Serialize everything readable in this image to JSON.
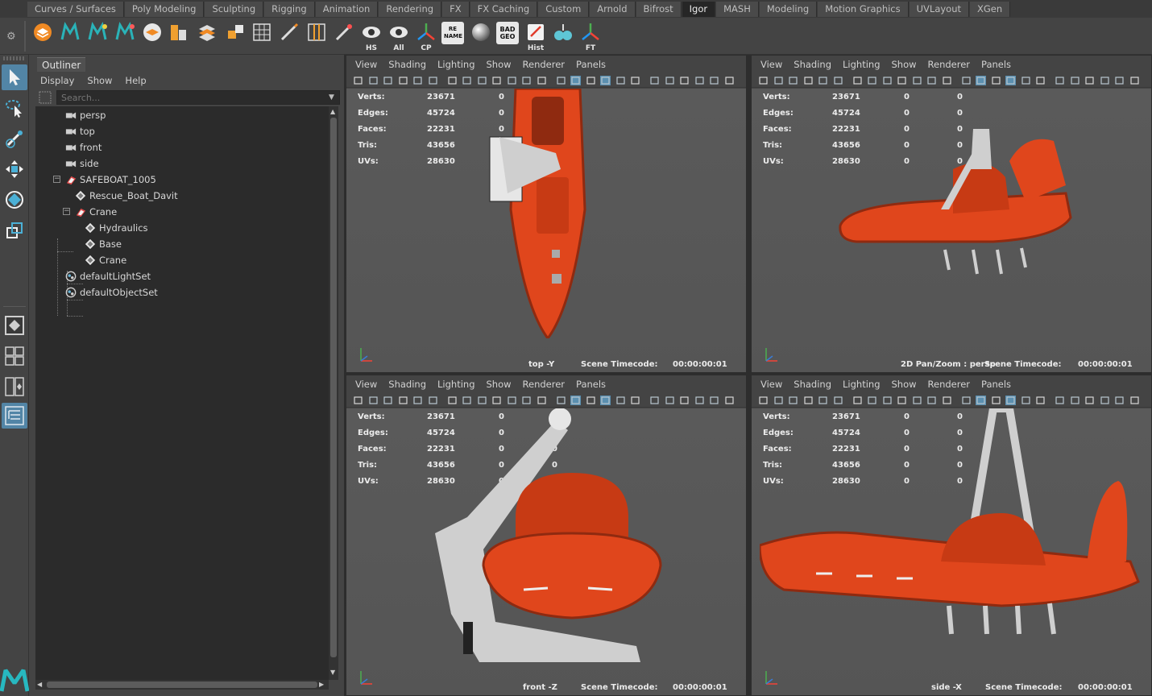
{
  "shelf": {
    "tabs": [
      "Curves / Surfaces",
      "Poly Modeling",
      "Sculpting",
      "Rigging",
      "Animation",
      "Rendering",
      "FX",
      "FX Caching",
      "Custom",
      "Arnold",
      "Bifrost",
      "Igor",
      "MASH",
      "Modeling",
      "Motion Graphics",
      "UVLayout",
      "XGen"
    ],
    "active_tab": "Igor",
    "labels": {
      "hs": "HS",
      "all": "All",
      "cp": "CP",
      "rename": "RE\nNAME",
      "badgeo": "BAD\nGEO",
      "hist": "Hist",
      "ft": "FT"
    },
    "rename_text": "RE NAME",
    "badgeo_text": "BAD GEO"
  },
  "outliner": {
    "tab_title": "Outliner",
    "menu": [
      "Display",
      "Show",
      "Help"
    ],
    "search_placeholder": "Search...",
    "items": [
      {
        "label": "persp",
        "icon": "camera-icon"
      },
      {
        "label": "top",
        "icon": "camera-icon"
      },
      {
        "label": "front",
        "icon": "camera-icon"
      },
      {
        "label": "side",
        "icon": "camera-icon"
      },
      {
        "label": "SAFEBOAT_1005",
        "icon": "group-icon"
      },
      {
        "label": "Rescue_Boat_Davit",
        "icon": "mesh-icon"
      },
      {
        "label": "Crane",
        "icon": "group-icon"
      },
      {
        "label": "Hydraulics",
        "icon": "mesh-icon"
      },
      {
        "label": "Base",
        "icon": "mesh-icon"
      },
      {
        "label": "Crane",
        "icon": "mesh-icon"
      },
      {
        "label": "defaultLightSet",
        "icon": "set-icon"
      },
      {
        "label": "defaultObjectSet",
        "icon": "set-icon"
      }
    ]
  },
  "viewport_menu": [
    "View",
    "Shading",
    "Lighting",
    "Show",
    "Renderer",
    "Panels"
  ],
  "hud": {
    "labels": [
      "Verts:",
      "Edges:",
      "Faces:",
      "Tris:",
      "UVs:"
    ],
    "values": [
      "23671",
      "45724",
      "22231",
      "43656",
      "28630"
    ],
    "zero": "0"
  },
  "viewports": [
    {
      "camera": "top -Y",
      "timecode_label": "Scene Timecode:",
      "timecode": "00:00:00:01",
      "extra": ""
    },
    {
      "camera": "persp",
      "timecode_label": "Scene Timecode:",
      "timecode": "00:00:00:01",
      "extra": "2D Pan/Zoom : persp"
    },
    {
      "camera": "front -Z",
      "timecode_label": "Scene Timecode:",
      "timecode": "00:00:00:01",
      "extra": ""
    },
    {
      "camera": "side -X",
      "timecode_label": "Scene Timecode:",
      "timecode": "00:00:00:01",
      "extra": ""
    }
  ],
  "colors": {
    "boat_orange": "#e0461c",
    "boat_dark": "#8f2a10",
    "crane_grey": "#cfcfcf",
    "viewport_bg": "#565656",
    "selected_tool": "#5285a6"
  }
}
